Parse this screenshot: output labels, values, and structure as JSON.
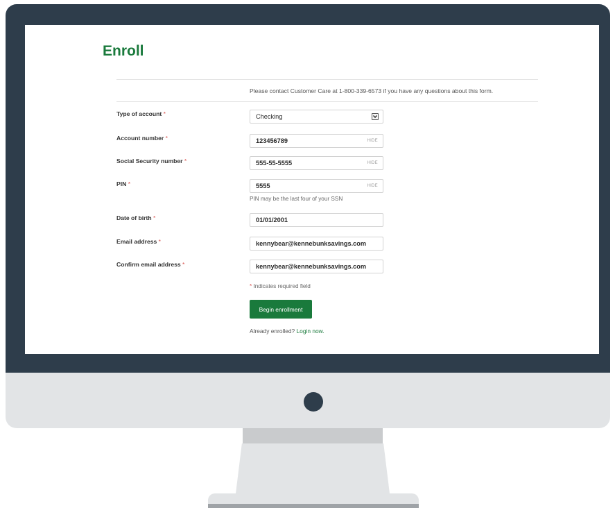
{
  "page": {
    "title": "Enroll",
    "notice": "Please contact Customer Care at 1-800-339-6573 if you have any questions about this form."
  },
  "form": {
    "account_type": {
      "label": "Type of account",
      "value": "Checking"
    },
    "account_number": {
      "label": "Account number",
      "value": "123456789",
      "toggle": "HIDE"
    },
    "ssn": {
      "label": "Social Security number",
      "value": "555-55-5555",
      "toggle": "HIDE"
    },
    "pin": {
      "label": "PIN",
      "value": "5555",
      "toggle": "HIDE",
      "hint": "PIN may be the last four of your SSN"
    },
    "dob": {
      "label": "Date of birth",
      "value": "01/01/2001"
    },
    "email": {
      "label": "Email address",
      "value": "kennybear@kennebunksavings.com"
    },
    "confirm_email": {
      "label": "Confirm email address",
      "value": "kennybear@kennebunksavings.com"
    },
    "required_marker": "*",
    "required_note": "Indicates required field",
    "submit_label": "Begin enrollment",
    "already_enrolled_text": "Already enrolled?",
    "login_link": "Login now."
  },
  "colors": {
    "brand_green": "#1a7a3c",
    "required_red": "#d9534f",
    "monitor_frame": "#2e3d4b"
  },
  "icons": {
    "select_arrow": "chevron-down-icon"
  }
}
